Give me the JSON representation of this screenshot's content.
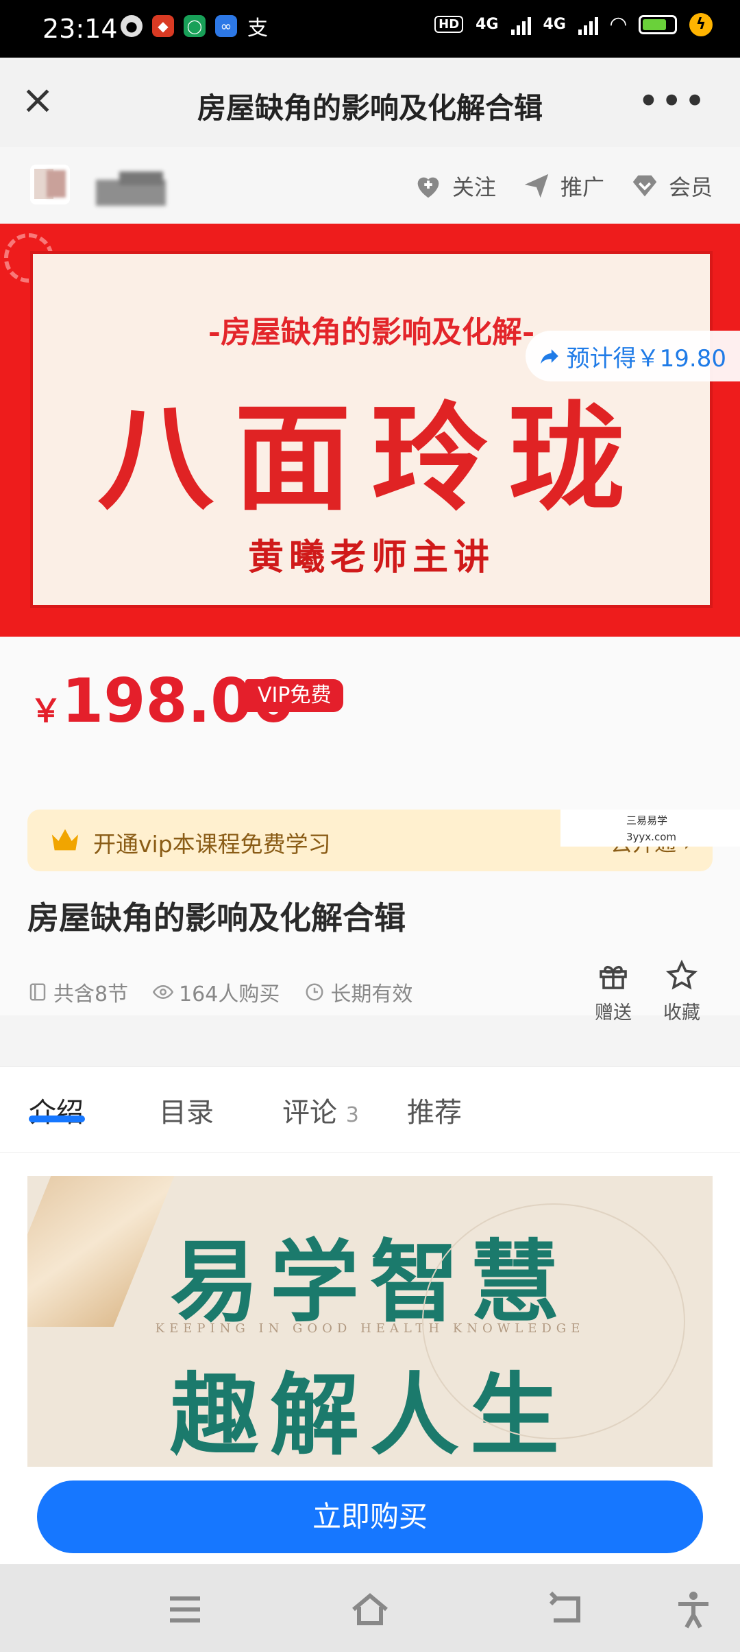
{
  "status_bar": {
    "time": "23:14",
    "hd_label": "HD",
    "network_1": "4G",
    "network_2": "4G"
  },
  "title_bar": {
    "title": "房屋缺角的影响及化解合辑"
  },
  "header_actions": {
    "follow": "关注",
    "promote": "推广",
    "member": "会员"
  },
  "banner": {
    "subtitle": "-房屋缺角的影响及化解-",
    "headline": "八面玲珑",
    "teacher": "黄曦老师主讲",
    "earn_pill": "预计得￥19.80"
  },
  "price": {
    "currency": "￥",
    "amount": "198.00",
    "vip_tag": "VIP免费"
  },
  "vip_bar": {
    "text": "开通vip本课程免费学习",
    "action": "去开通 ›",
    "watermark_line1": "三易易学",
    "watermark_line2": "3yyx.com"
  },
  "course": {
    "title": "房屋缺角的影响及化解合辑",
    "sections": "共含8节",
    "purchases": "164人购买",
    "validity": "长期有效",
    "gift": "赠送",
    "favorite": "收藏"
  },
  "tabs": [
    {
      "label": "介绍"
    },
    {
      "label": "目录"
    },
    {
      "label": "评论",
      "count": "3"
    },
    {
      "label": "推荐"
    }
  ],
  "intro_image": {
    "line1": "易学智慧",
    "english": "KEEPING IN GOOD HEALTH KNOWLEDGE",
    "line2": "趣解人生"
  },
  "buy_button": "立即购买",
  "colors": {
    "accent_blue": "#1677ff",
    "price_red": "#e41f2b",
    "banner_red": "#ee1c1c",
    "intro_green": "#1b7a6c"
  }
}
